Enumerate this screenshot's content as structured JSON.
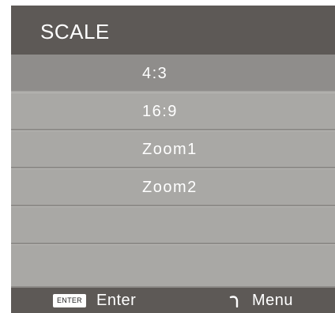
{
  "title": "SCALE",
  "options": [
    {
      "label": "4:3",
      "selected": true
    },
    {
      "label": "16:9",
      "selected": false
    },
    {
      "label": "Zoom1",
      "selected": false
    },
    {
      "label": "Zoom2",
      "selected": false
    },
    {
      "label": "",
      "selected": false
    },
    {
      "label": "",
      "selected": false
    }
  ],
  "footer": {
    "enter_key": "ENTER",
    "enter_label": "Enter",
    "menu_icon": "return-icon",
    "menu_label": "Menu"
  }
}
